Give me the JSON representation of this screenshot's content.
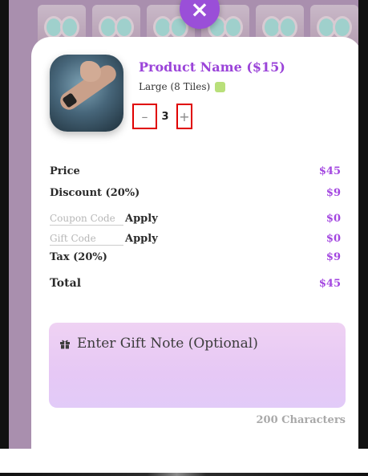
{
  "header": {
    "close_label": "×"
  },
  "product": {
    "title": "Product Name ($15)",
    "size_label": "Large (8 Tiles)",
    "swatch_color": "#b9e07a",
    "quantity": "3",
    "decrement_label": "–",
    "increment_label": "+"
  },
  "summary": {
    "price_label": "Price",
    "price_value": "$45",
    "discount_label": "Discount (20%)",
    "discount_value": "$9",
    "coupon_placeholder": "Coupon Code",
    "coupon_apply": "Apply",
    "coupon_value": "$0",
    "gift_code_placeholder": "Gift Code",
    "gift_code_apply": "Apply",
    "gift_code_value": "$0",
    "tax_label": "Tax (20%)",
    "tax_value": "$9",
    "total_label": "Total",
    "total_value": "$45"
  },
  "gift_note": {
    "icon": "gift-icon",
    "placeholder": "Enter Gift Note (Optional)",
    "char_count": "200 Characters"
  },
  "colors": {
    "accent": "#9b44d9",
    "value": "#a347e0",
    "close_button": "#9a4fd8"
  }
}
